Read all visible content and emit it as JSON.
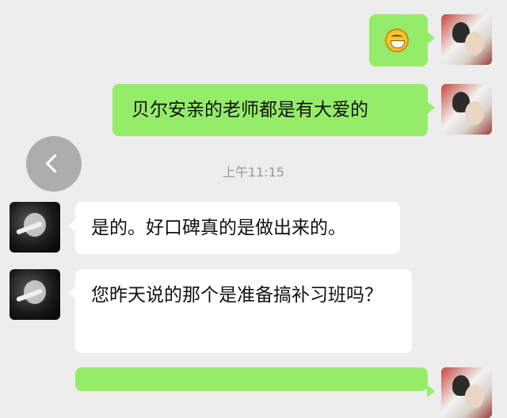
{
  "messages": [
    {
      "sender": "me",
      "type": "emoji",
      "icon": "grinning-face-emoji"
    },
    {
      "sender": "me",
      "type": "text",
      "text": "贝尔安亲的老师都是有大爱的"
    },
    {
      "sender": "other",
      "type": "text",
      "text": "是的。好口碑真的是做出来的。"
    },
    {
      "sender": "other",
      "type": "text",
      "text": "您昨天说的那个是准备搞补习班吗？"
    },
    {
      "sender": "me",
      "type": "text",
      "text": ""
    }
  ],
  "timestamp": "上午11:15",
  "colors": {
    "background": "#ededed",
    "my_bubble": "#95ec69",
    "other_bubble": "#ffffff",
    "timestamp": "#999999"
  },
  "icons": {
    "back": "chevron-left-icon"
  }
}
